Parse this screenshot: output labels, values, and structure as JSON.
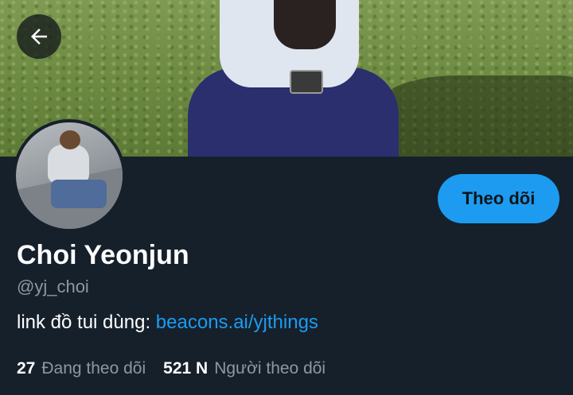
{
  "profile": {
    "name": "Choi Yeonjun",
    "handle": "@yj_choi",
    "bio_text": "link đồ tui dùng: ",
    "bio_link": "beacons.ai/yjthings",
    "follow_label": "Theo dõi"
  },
  "stats": {
    "following_count": "27",
    "following_label": "Đang theo dõi",
    "followers_count": "521 N",
    "followers_label": "Người theo dõi"
  },
  "icons": {
    "back": "arrow-left-icon"
  },
  "colors": {
    "background": "#15202b",
    "accent": "#1d9bf0",
    "secondary_text": "#8b98a5"
  }
}
